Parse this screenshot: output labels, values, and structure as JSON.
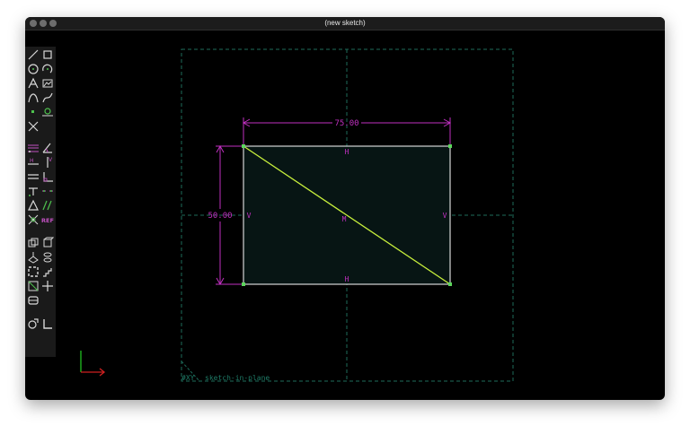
{
  "window": {
    "title": "(new sketch)"
  },
  "sketch": {
    "horizontal_dimension": "75.00",
    "vertical_dimension": "50.00",
    "constraint_h": "H",
    "constraint_v": "V",
    "constraint_m": "M",
    "workplane_label": "#XY",
    "workplane_name": "sketch-in-plane"
  },
  "colors": {
    "background": "#000000",
    "dimension": "#c030c0",
    "entity": "#ffffff",
    "selected_line": "#c8f03c",
    "point": "#5cd65c",
    "workplane": "#1e6b5a",
    "tool_icon": "#d8d8d8",
    "tool_icon_green": "#4ec24e",
    "tool_icon_purple": "#c050c0",
    "axis_x": "#d02020",
    "axis_y": "#20c020"
  },
  "toolbar": {
    "tools": [
      "line-icon",
      "rectangle-icon",
      "circle-icon",
      "arc-icon",
      "text-icon",
      "image-icon",
      "bezier-icon",
      "spline-icon",
      "point-icon",
      "tangent-arc-icon",
      "split-icon",
      "distance-constraint-icon",
      "angle-constraint-icon",
      "horizontal-icon",
      "vertical-icon",
      "parallel-icon",
      "perpendicular-icon",
      "on-point-icon",
      "symmetric-icon",
      "equal-angle-icon",
      "ref-icon",
      "reference-icon",
      "step-translate-icon",
      "step-rotate-icon",
      "extrude-icon",
      "lathe-icon",
      "helix-icon",
      "revolve-icon",
      "nearest-ortho-icon",
      "nearest-iso-icon",
      "show-hidden-icon",
      "workplane-icon",
      "home-icon",
      "ortho-icon"
    ],
    "ref_label": "REF"
  }
}
